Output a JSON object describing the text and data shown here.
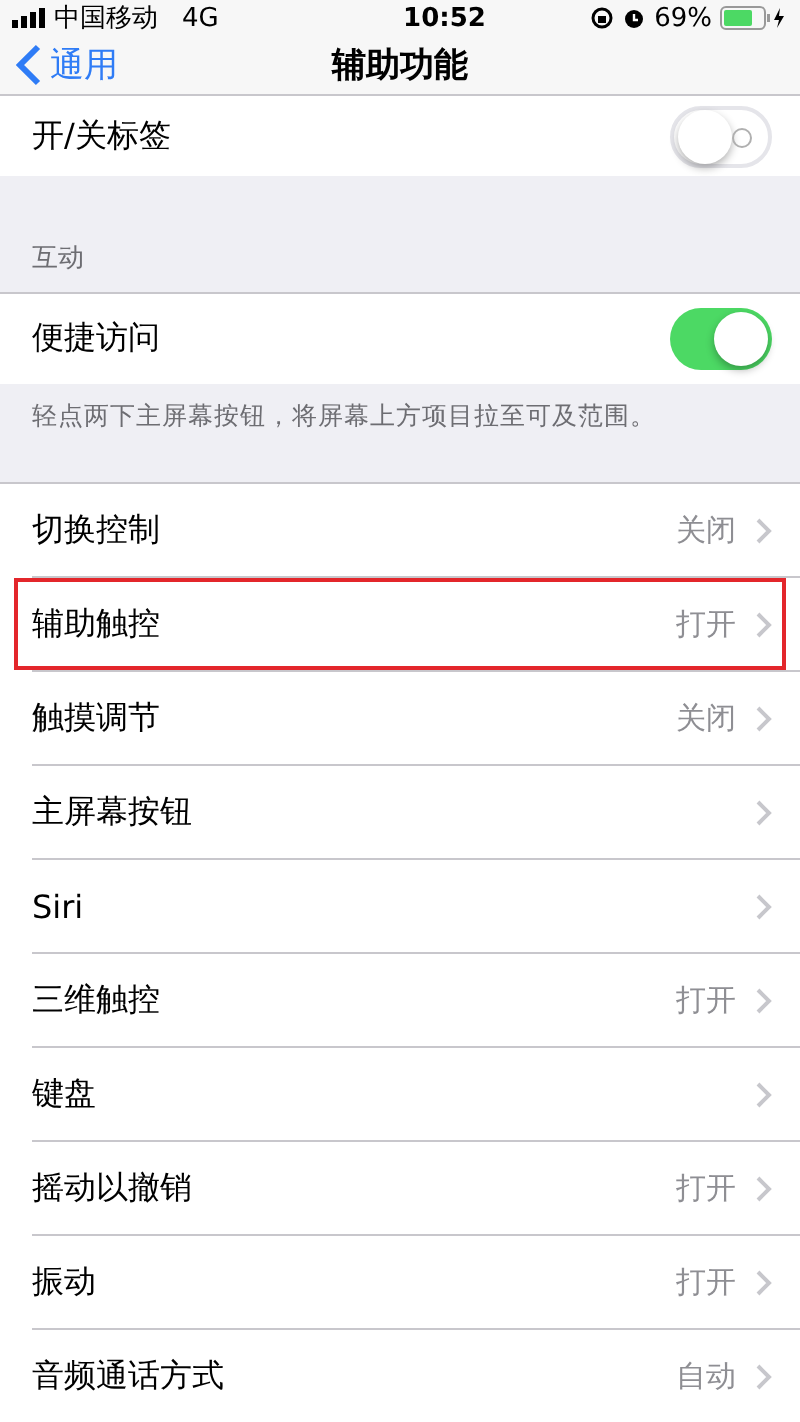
{
  "status_bar": {
    "carrier": "中国移动",
    "network": "4G",
    "time": "10:52",
    "battery": "69%"
  },
  "nav": {
    "back": "通用",
    "title": "辅助功能"
  },
  "top_rows": [
    {
      "label": "开/关标签",
      "kind": "toggle",
      "on": false
    }
  ],
  "groups": [
    {
      "header": "互动",
      "rows": [
        {
          "label": "便捷访问",
          "kind": "toggle",
          "on": true
        }
      ],
      "footer": "轻点两下主屏幕按钮，将屏幕上方项目拉至可及范围。"
    },
    {
      "rows": [
        {
          "label": "切换控制",
          "kind": "link",
          "value": "关闭",
          "highlighted": false
        },
        {
          "label": "辅助触控",
          "kind": "link",
          "value": "打开",
          "highlighted": true
        },
        {
          "label": "触摸调节",
          "kind": "link",
          "value": "关闭",
          "highlighted": false
        },
        {
          "label": "主屏幕按钮",
          "kind": "link",
          "highlighted": false
        },
        {
          "label": "Siri",
          "kind": "link",
          "highlighted": false
        },
        {
          "label": "三维触控",
          "kind": "link",
          "value": "打开",
          "highlighted": false
        },
        {
          "label": "键盘",
          "kind": "link",
          "highlighted": false
        },
        {
          "label": "摇动以撤销",
          "kind": "link",
          "value": "打开",
          "highlighted": false
        },
        {
          "label": "振动",
          "kind": "link",
          "value": "打开",
          "highlighted": false
        },
        {
          "label": "音频通话方式",
          "kind": "link",
          "value": "自动",
          "highlighted": false
        }
      ]
    }
  ]
}
